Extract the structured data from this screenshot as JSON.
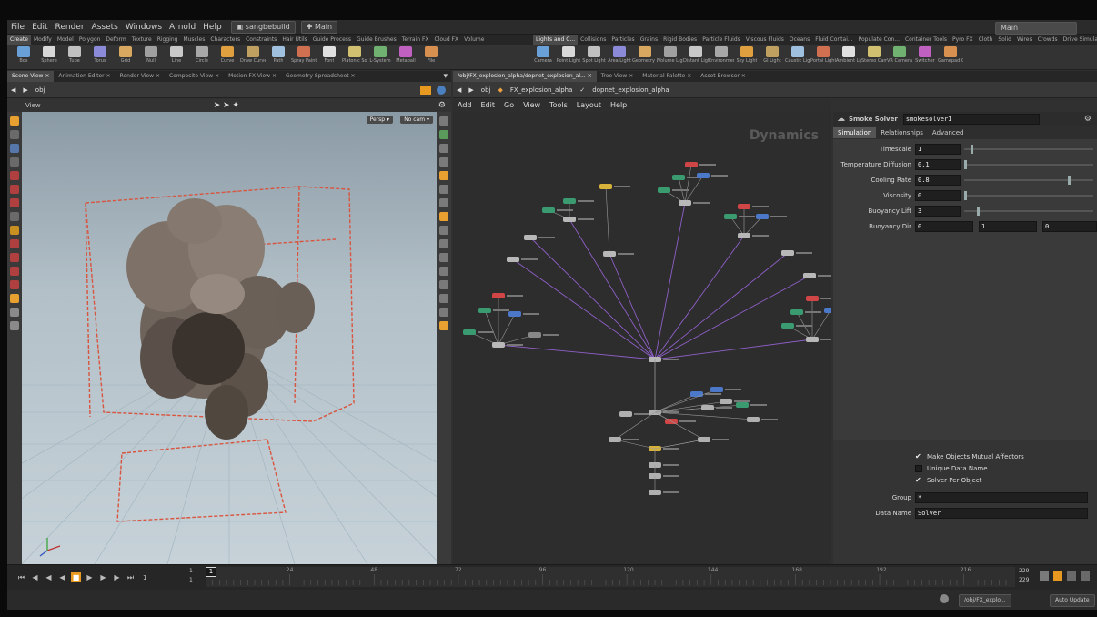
{
  "menubar": {
    "items": [
      "File",
      "Edit",
      "Render",
      "Assets",
      "Windows",
      "Arnold",
      "Help"
    ],
    "build": "sangbebuild",
    "desktop": "Main",
    "right_desktop": "Main"
  },
  "shelf_tabs_left": [
    "Create",
    "Modify",
    "Model",
    "Polygon",
    "Deform",
    "Texture",
    "Rigging",
    "Muscles",
    "Characters",
    "Constraints",
    "Hair Utils",
    "Guide Process",
    "Guide Brushes",
    "Terrain FX",
    "Cloud FX",
    "Volume"
  ],
  "shelf_tabs_right": [
    "Lights and C...",
    "Collisions",
    "Particles",
    "Grains",
    "Rigid Bodies",
    "Particle Fluids",
    "Viscous Fluids",
    "Oceans",
    "Fluid Contai...",
    "Populate Con...",
    "Container Tools",
    "Pyro FX",
    "Cloth",
    "Solid",
    "Wires",
    "Crowds",
    "Drive Simula..."
  ],
  "tools_left": [
    "Box",
    "Sphere",
    "Tube",
    "Torus",
    "Grid",
    "Null",
    "Line",
    "Circle",
    "Curve",
    "Draw Curve",
    "Path",
    "Spray Paint",
    "Font",
    "Platonic Solids",
    "L-System",
    "Metaball",
    "File"
  ],
  "tools_right": [
    "Camera",
    "Point Light",
    "Spot Light",
    "Area Light",
    "Geometry Light",
    "Volume Light",
    "Distant Light",
    "Environment Light",
    "Sky Light",
    "GI Light",
    "Caustic Light",
    "Portal Light",
    "Ambient Light",
    "Stereo Camera",
    "VR Camera",
    "Switcher",
    "Gamepad Camera"
  ],
  "left_pane_tabs": [
    "Scene View",
    "Animation Editor",
    "Render View",
    "Composite View",
    "Motion FX View",
    "Geometry Spreadsheet"
  ],
  "right_pane_tabs": [
    "/obj/FX_explosion_alpha/dopnet_explosion_al...",
    "Tree View",
    "Material Palette",
    "Asset Browser"
  ],
  "left_path": "obj",
  "right_path": [
    "obj",
    "FX_explosion_alpha",
    "dopnet_explosion_alpha"
  ],
  "viewport": {
    "title": "View",
    "persp": "Persp ▾",
    "cam": "No cam ▾"
  },
  "network": {
    "menu": [
      "Add",
      "Edit",
      "Go",
      "View",
      "Tools",
      "Layout",
      "Help"
    ],
    "context": "Dynamics"
  },
  "params": {
    "node_type": "Smoke Solver",
    "node_name": "smokesolver1",
    "tabs": [
      "Simulation",
      "Relationships",
      "Advanced"
    ],
    "rows": [
      {
        "label": "Timescale",
        "value": "1",
        "level": 0.05
      },
      {
        "label": "Temperature Diffusion",
        "value": "0.1",
        "level": 0.0
      },
      {
        "label": "Cooling Rate",
        "value": "0.8",
        "level": 0.8
      },
      {
        "label": "Viscosity",
        "value": "0",
        "level": 0.0
      },
      {
        "label": "Buoyancy Lift",
        "value": "3",
        "level": 0.1
      }
    ],
    "buoyancy_dir": {
      "label": "Buoyancy Dir",
      "x": "0",
      "y": "1",
      "z": "0"
    },
    "checks": [
      {
        "label": "Make Objects Mutual Affectors",
        "checked": true
      },
      {
        "label": "Unique Data Name",
        "checked": false
      },
      {
        "label": "Solver Per Object",
        "checked": true
      }
    ],
    "group": {
      "label": "Group",
      "value": "*"
    },
    "data_name": {
      "label": "Data Name",
      "value": "Solver"
    }
  },
  "timeline": {
    "start": "1",
    "start2": "1",
    "current": "1",
    "ticks": [
      "24",
      "48",
      "72",
      "96",
      "120",
      "144",
      "168",
      "192",
      "216"
    ],
    "end": "229",
    "end2": "229"
  },
  "statusbar": {
    "path": "/obj/FX_explo...",
    "update": "Auto Update"
  },
  "colors": {
    "wire": "#8f5fc8",
    "node_red": "#d04545",
    "node_green": "#3a9a70",
    "node_blue": "#4b78c8",
    "node_yellow": "#d6b23a",
    "highlight": "#f0a020"
  }
}
